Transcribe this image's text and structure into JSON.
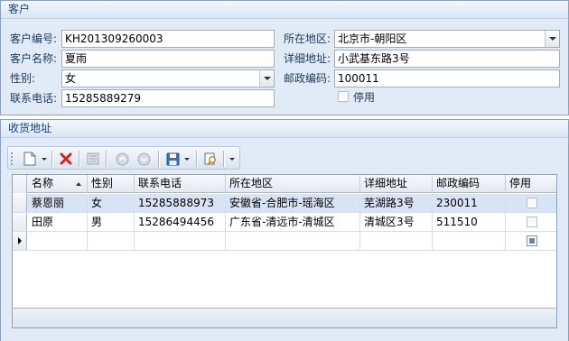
{
  "customer_group": {
    "title": "客户",
    "code_label": "客户编号:",
    "code_value": "KH201309260003",
    "name_label": "客户名称:",
    "name_value": "夏雨",
    "gender_label": "性别:",
    "gender_value": "女",
    "phone_label": "联系电话:",
    "phone_value": "15285889279",
    "region_label": "所在地区:",
    "region_value": "北京市-朝阳区",
    "address_label": "详细地址:",
    "address_value": "小武基东路3号",
    "zip_label": "邮政编码:",
    "zip_value": "100011",
    "disabled_label": "停用",
    "disabled_checked": false
  },
  "shipping_group": {
    "title": "收货地址",
    "toolbar_icons": [
      "new-icon",
      "delete-icon",
      "details-icon",
      "move-up-icon",
      "move-down-icon",
      "save-icon",
      "find-icon"
    ],
    "columns": [
      "名称",
      "性别",
      "联系电话",
      "所在地区",
      "详细地址",
      "邮政编码",
      "停用"
    ],
    "sort_column": "名称",
    "rows": [
      {
        "name": "蔡恩丽",
        "gender": "女",
        "phone": "15285888973",
        "region": "安徽省-合肥市-瑶海区",
        "address": "芜湖路3号",
        "zip": "230011",
        "disabled": false
      },
      {
        "name": "田原",
        "gender": "男",
        "phone": "15286494456",
        "region": "广东省-清远市-清城区",
        "address": "清城区3号",
        "zip": "511510",
        "disabled": false
      }
    ]
  },
  "colors": {
    "panel_bg": "#e1ebf7",
    "header_text": "#15428b",
    "selected_row": "#d7e4f5",
    "delete_red": "#d42020"
  }
}
